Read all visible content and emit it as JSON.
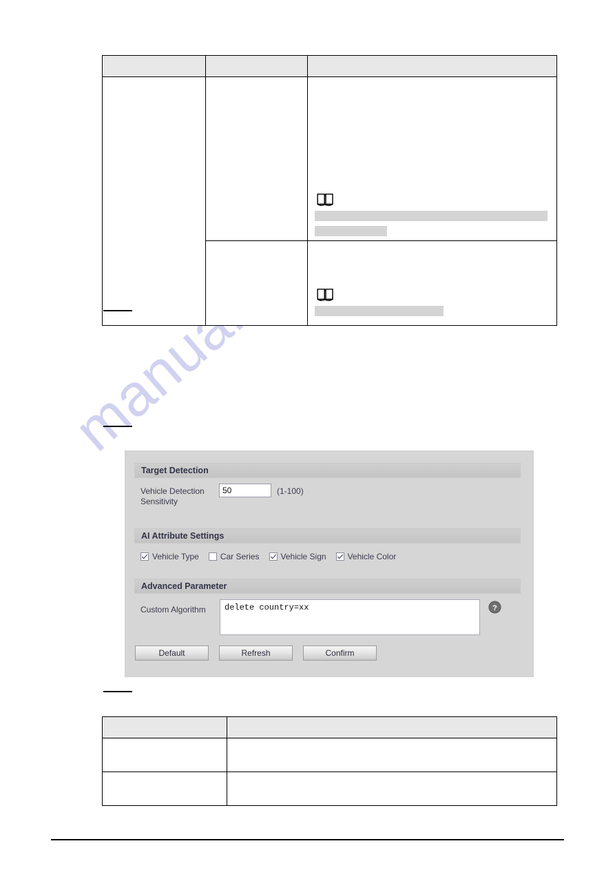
{
  "document": {
    "watermark": "manualshive.com"
  },
  "tables": {
    "top": {
      "name": "parameter-description-table-top",
      "headers": [
        "",
        "",
        ""
      ],
      "rows": [
        {
          "cells": [
            "",
            "",
            ""
          ],
          "note": {
            "icon": "book-note-icon",
            "lines": [
              "",
              ""
            ]
          }
        },
        {
          "cells": [
            "",
            ""
          ],
          "note": {
            "icon": "book-note-icon",
            "lines": [
              ""
            ]
          }
        }
      ]
    },
    "bottom": {
      "name": "parameter-description-table-bottom",
      "headers": [
        "",
        ""
      ],
      "rows": [
        {
          "cells": [
            "",
            ""
          ]
        },
        {
          "cells": [
            "",
            ""
          ]
        }
      ]
    }
  },
  "captions": {
    "figure_above_table": "",
    "figure_below_table": "",
    "table_caption": ""
  },
  "config_panel": {
    "sections": {
      "target_detection": {
        "title": "Target Detection",
        "sensitivity_label": "Vehicle Detection\nSensitivity",
        "sensitivity_value": "50",
        "sensitivity_range_hint": "(1-100)"
      },
      "ai_attribute_settings": {
        "title": "AI Attribute Settings",
        "checkboxes": [
          {
            "label": "Vehicle Type",
            "checked": true
          },
          {
            "label": "Car Series",
            "checked": false
          },
          {
            "label": "Vehicle Sign",
            "checked": true
          },
          {
            "label": "Vehicle Color",
            "checked": true
          }
        ]
      },
      "advanced_parameter": {
        "title": "Advanced Parameter",
        "custom_algorithm_label": "Custom Algorithm",
        "custom_algorithm_value": "delete country=xx",
        "help_icon": "help-question-icon"
      }
    },
    "buttons": [
      {
        "name": "default-button",
        "label": "Default"
      },
      {
        "name": "refresh-button",
        "label": "Refresh"
      },
      {
        "name": "confirm-button",
        "label": "Confirm"
      }
    ]
  },
  "colors": {
    "panel_bg": "#d6d6d6",
    "section_header_bg": "#c8c8c8",
    "table_header_bg": "#e8e8e8",
    "redaction_bar": "#d4d4d4",
    "watermark": "#c9cbee",
    "text": "#33334a"
  }
}
